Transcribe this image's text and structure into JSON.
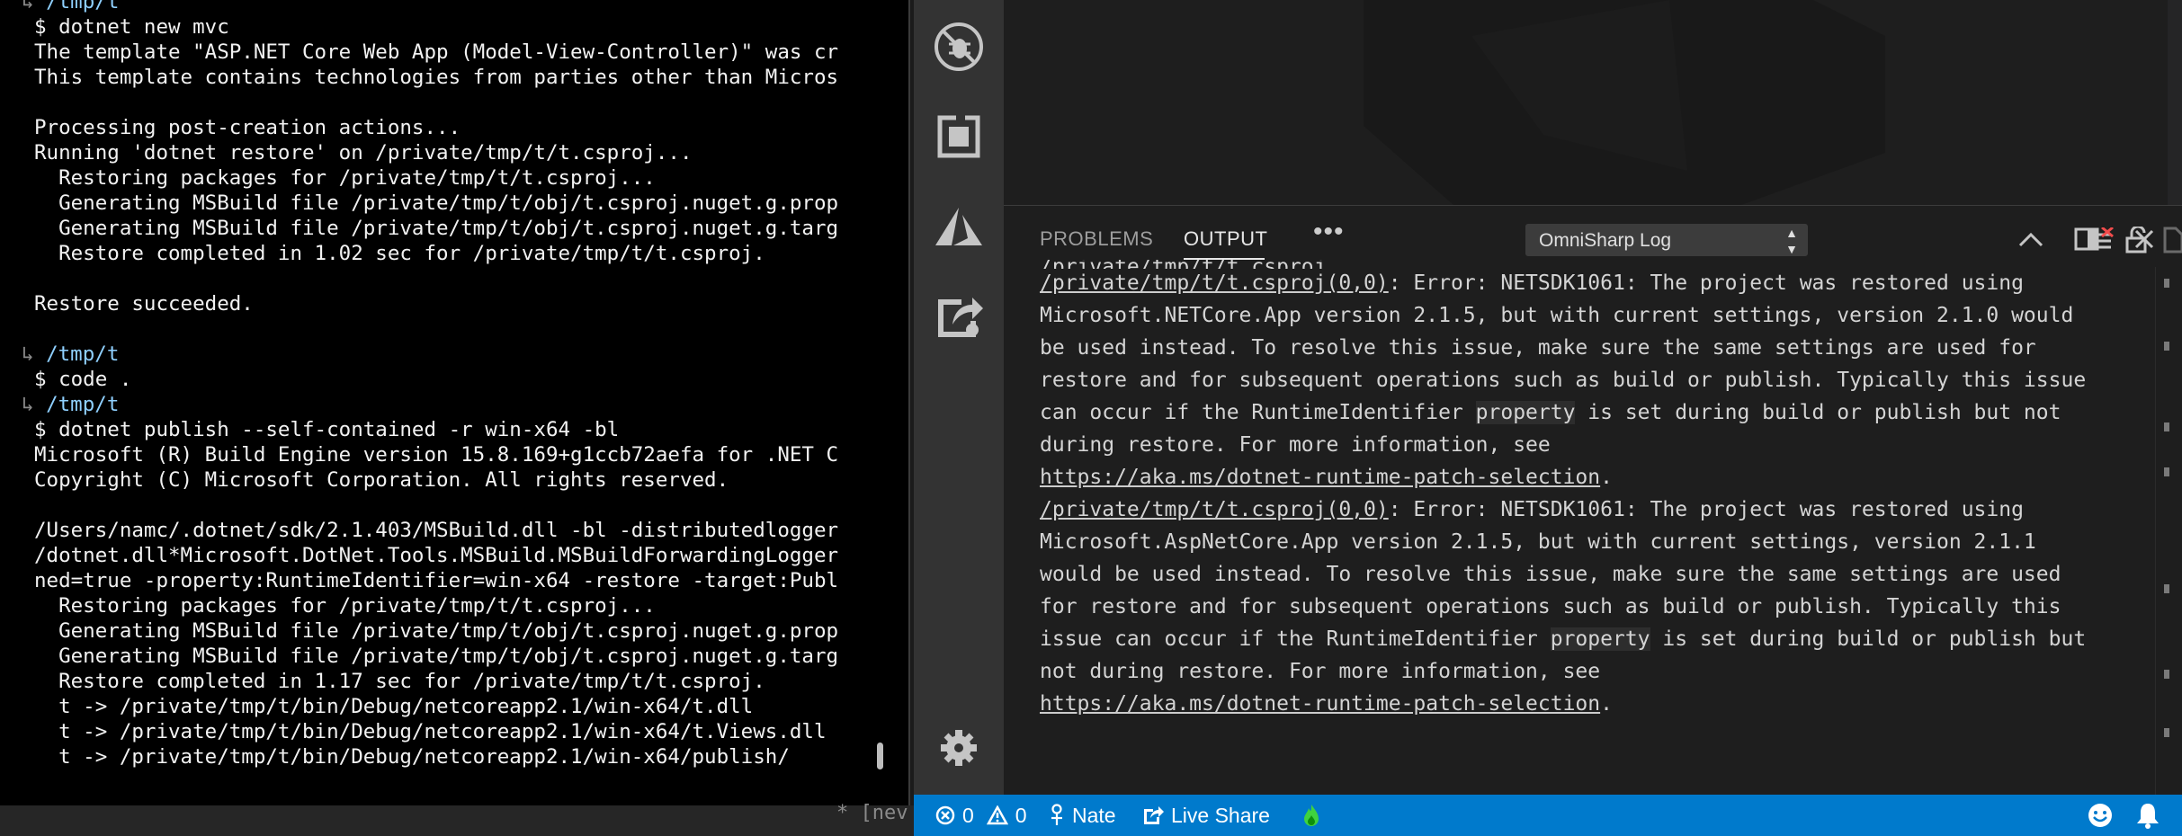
{
  "terminal": {
    "lines": [
      {
        "kind": "path",
        "text": "/tmp/t"
      },
      {
        "kind": "text",
        "text": "$ dotnet new mvc"
      },
      {
        "kind": "text",
        "text": "The template \"ASP.NET Core Web App (Model-View-Controller)\" was cr"
      },
      {
        "kind": "text",
        "text": "This template contains technologies from parties other than Micros"
      },
      {
        "kind": "text",
        "text": ""
      },
      {
        "kind": "text",
        "text": "Processing post-creation actions..."
      },
      {
        "kind": "text",
        "text": "Running 'dotnet restore' on /private/tmp/t/t.csproj..."
      },
      {
        "kind": "text",
        "text": "  Restoring packages for /private/tmp/t/t.csproj..."
      },
      {
        "kind": "text",
        "text": "  Generating MSBuild file /private/tmp/t/obj/t.csproj.nuget.g.prop"
      },
      {
        "kind": "text",
        "text": "  Generating MSBuild file /private/tmp/t/obj/t.csproj.nuget.g.targ"
      },
      {
        "kind": "text",
        "text": "  Restore completed in 1.02 sec for /private/tmp/t/t.csproj."
      },
      {
        "kind": "text",
        "text": ""
      },
      {
        "kind": "text",
        "text": "Restore succeeded."
      },
      {
        "kind": "text",
        "text": ""
      },
      {
        "kind": "path",
        "text": "/tmp/t"
      },
      {
        "kind": "text",
        "text": "$ code ."
      },
      {
        "kind": "path",
        "text": "/tmp/t"
      },
      {
        "kind": "text",
        "text": "$ dotnet publish --self-contained -r win-x64 -bl"
      },
      {
        "kind": "text",
        "text": "Microsoft (R) Build Engine version 15.8.169+g1ccb72aefa for .NET C"
      },
      {
        "kind": "text",
        "text": "Copyright (C) Microsoft Corporation. All rights reserved."
      },
      {
        "kind": "text",
        "text": ""
      },
      {
        "kind": "text",
        "text": "/Users/namc/.dotnet/sdk/2.1.403/MSBuild.dll -bl -distributedlogger"
      },
      {
        "kind": "text",
        "text": "/dotnet.dll*Microsoft.DotNet.Tools.MSBuild.MSBuildForwardingLogger"
      },
      {
        "kind": "text",
        "text": "ned=true -property:RuntimeIdentifier=win-x64 -restore -target:Publ"
      },
      {
        "kind": "text",
        "text": "  Restoring packages for /private/tmp/t/t.csproj..."
      },
      {
        "kind": "text",
        "text": "  Generating MSBuild file /private/tmp/t/obj/t.csproj.nuget.g.prop"
      },
      {
        "kind": "text",
        "text": "  Generating MSBuild file /private/tmp/t/obj/t.csproj.nuget.g.targ"
      },
      {
        "kind": "text",
        "text": "  Restore completed in 1.17 sec for /private/tmp/t/t.csproj."
      },
      {
        "kind": "text",
        "text": "  t -> /private/tmp/t/bin/Debug/netcoreapp2.1/win-x64/t.dll"
      },
      {
        "kind": "text",
        "text": "  t -> /private/tmp/t/bin/Debug/netcoreapp2.1/win-x64/t.Views.dll"
      },
      {
        "kind": "text",
        "text": "  t -> /private/tmp/t/bin/Debug/netcoreapp2.1/win-x64/publish/"
      }
    ],
    "hook_glyph": "↳"
  },
  "background_editor_text": "* [nev",
  "activity_bar": {
    "icons": [
      "debug-icon",
      "extensions-icon",
      "azure-icon",
      "live-share-icon",
      "settings-gear-icon"
    ]
  },
  "panel": {
    "tabs": {
      "problems": "PROBLEMS",
      "output": "OUTPUT",
      "more": "•••"
    },
    "channel": "OmniSharp Log",
    "output_lines": [
      [
        {
          "t": "/private/tmp/t/t.csproj(0,0)",
          "u": true
        },
        {
          "t": ": Error: NETSDK1061: The project was restored using"
        }
      ],
      [
        {
          "t": "Microsoft.NETCore.App version 2.1.5, but with current settings, version 2.1.0 would"
        }
      ],
      [
        {
          "t": "be used instead. To resolve this issue, make sure the same settings are used for"
        }
      ],
      [
        {
          "t": "restore and for subsequent operations such as build or publish. Typically this issue"
        }
      ],
      [
        {
          "t": "can occur if the RuntimeIdentifier "
        },
        {
          "t": "property",
          "h": true
        },
        {
          "t": " is set during build or publish but not"
        }
      ],
      [
        {
          "t": "during restore. For more information, see"
        }
      ],
      [
        {
          "t": "https://aka.ms/dotnet-runtime-patch-selection",
          "u": true
        },
        {
          "t": "."
        }
      ],
      [
        {
          "t": "/private/tmp/t/t.csproj(0,0)",
          "u": true
        },
        {
          "t": ": Error: NETSDK1061: The project was restored using"
        }
      ],
      [
        {
          "t": "Microsoft.AspNetCore.App version 2.1.5, but with current settings, version 2.1.1"
        }
      ],
      [
        {
          "t": "would be used instead. To resolve this issue, make sure the same settings are used"
        }
      ],
      [
        {
          "t": "for restore and for subsequent operations such as build or publish. Typically this"
        }
      ],
      [
        {
          "t": "issue can occur if the RuntimeIdentifier "
        },
        {
          "t": "property",
          "h": true
        },
        {
          "t": " is set during build or publish but"
        }
      ],
      [
        {
          "t": "not during restore. For more information, see"
        }
      ],
      [
        {
          "t": "https://aka.ms/dotnet-runtime-patch-selection",
          "u": true
        },
        {
          "t": "."
        }
      ]
    ]
  },
  "statusbar": {
    "errors": "0",
    "warnings": "0",
    "user": "Nate",
    "live_share": "Live Share"
  },
  "colors": {
    "statusbar": "#007acc",
    "activity_bar": "#333333",
    "panel_bg": "#1e1e1e",
    "terminal_bg": "#000000"
  }
}
